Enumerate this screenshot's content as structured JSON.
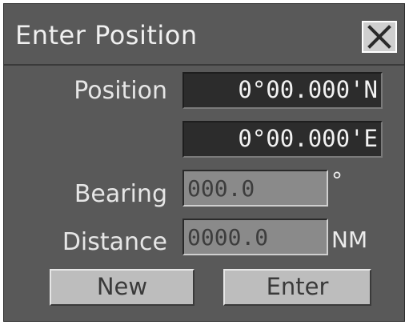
{
  "dialog": {
    "title": "Enter Position",
    "close_icon": "close-x-icon"
  },
  "position": {
    "label": "Position",
    "latitude": "0°00.000'N",
    "longitude": "0°00.000'E"
  },
  "bearing": {
    "label": "Bearing",
    "placeholder": "000.0",
    "value": "",
    "unit": "°"
  },
  "distance": {
    "label": "Distance",
    "placeholder": "0000.0",
    "value": "",
    "unit": "NM"
  },
  "buttons": {
    "new_label": "New",
    "enter_label": "Enter"
  },
  "colors": {
    "panel": "#595959",
    "readout_bg": "#2c2c2c",
    "input_bg": "#8a8a8a",
    "button_bg": "#bdbdbd"
  }
}
